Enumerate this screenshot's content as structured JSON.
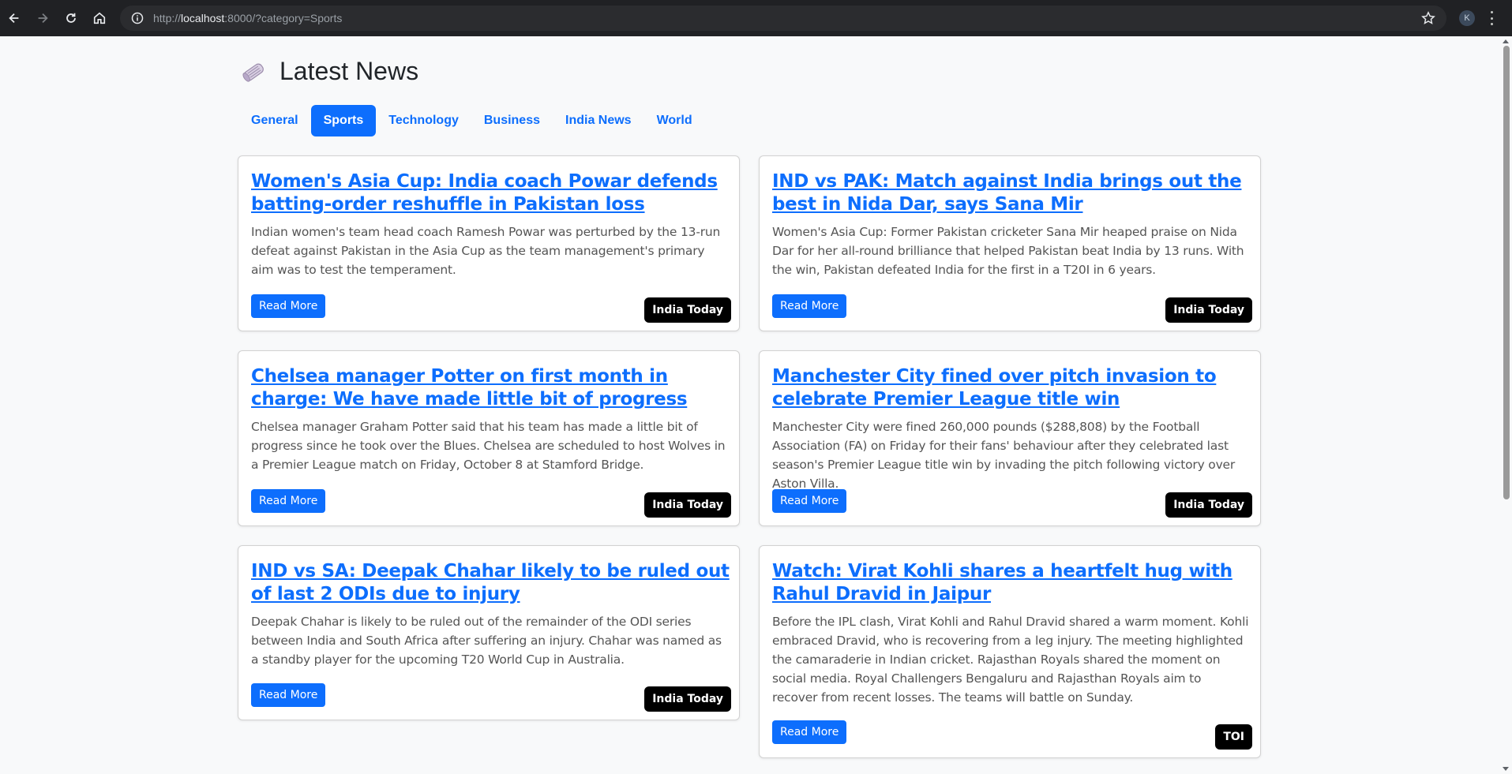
{
  "browser": {
    "url_prefix": "http://",
    "url_host": "localhost",
    "url_rest": ":8000/?category=Sports",
    "profile_initial": "K"
  },
  "page": {
    "title": "Latest News",
    "icon": "newspaper-icon"
  },
  "tabs": [
    {
      "label": "General",
      "active": false
    },
    {
      "label": "Sports",
      "active": true
    },
    {
      "label": "Technology",
      "active": false
    },
    {
      "label": "Business",
      "active": false
    },
    {
      "label": "India News",
      "active": false
    },
    {
      "label": "World",
      "active": false
    }
  ],
  "articles": [
    {
      "title": "Women's Asia Cup: India coach Powar defends batting-order reshuffle in Pakistan loss",
      "description": "Indian women's team head coach Ramesh Powar was perturbed by the 13-run defeat against Pakistan in the Asia Cup as the team management's primary aim was to test the temperament.",
      "read_more": "Read More",
      "source": "India Today"
    },
    {
      "title": "IND vs PAK: Match against India brings out the best in Nida Dar, says Sana Mir",
      "description": "Women's Asia Cup: Former Pakistan cricketer Sana Mir heaped praise on Nida Dar for her all-round brilliance that helped Pakistan beat India by 13 runs. With the win, Pakistan defeated India for the first in a T20I in 6 years.",
      "read_more": "Read More",
      "source": "India Today"
    },
    {
      "title": "Chelsea manager Potter on first month in charge: We have made little bit of progress",
      "description": "Chelsea manager Graham Potter said that his team has made a little bit of progress since he took over the Blues. Chelsea are scheduled to host Wolves in a Premier League match on Friday, October 8 at Stamford Bridge.",
      "read_more": "Read More",
      "source": "India Today"
    },
    {
      "title": "Manchester City fined over pitch invasion to celebrate Premier League title win",
      "description": "Manchester City were fined 260,000 pounds ($288,808) by the Football Association (FA) on Friday for their fans' behaviour after they celebrated last season's Premier League title win by invading the pitch following victory over Aston Villa.",
      "read_more": "Read More",
      "source": "India Today"
    },
    {
      "title": "IND vs SA: Deepak Chahar likely to be ruled out of last 2 ODIs due to injury",
      "description": "Deepak Chahar is likely to be ruled out of the remainder of the ODI series between India and South Africa after suffering an injury. Chahar was named as a standby player for the upcoming T20 World Cup in Australia.",
      "read_more": "Read More",
      "source": "India Today"
    },
    {
      "title": "Watch: Virat Kohli shares a heartfelt hug with Rahul Dravid in Jaipur",
      "description": "Before the IPL clash, Virat Kohli and Rahul Dravid shared a warm moment. Kohli embraced Dravid, who is recovering from a leg injury. The meeting highlighted the camaraderie in Indian cricket. Rajasthan Royals shared the moment on social media. Royal Challengers Bengaluru and Rajasthan Royals aim to recover from recent losses. The teams will battle on Sunday.",
      "read_more": "Read More",
      "source": "TOI"
    }
  ],
  "colors": {
    "accent": "#0d6efd",
    "badge": "#000000",
    "background": "#f8f9fa"
  }
}
